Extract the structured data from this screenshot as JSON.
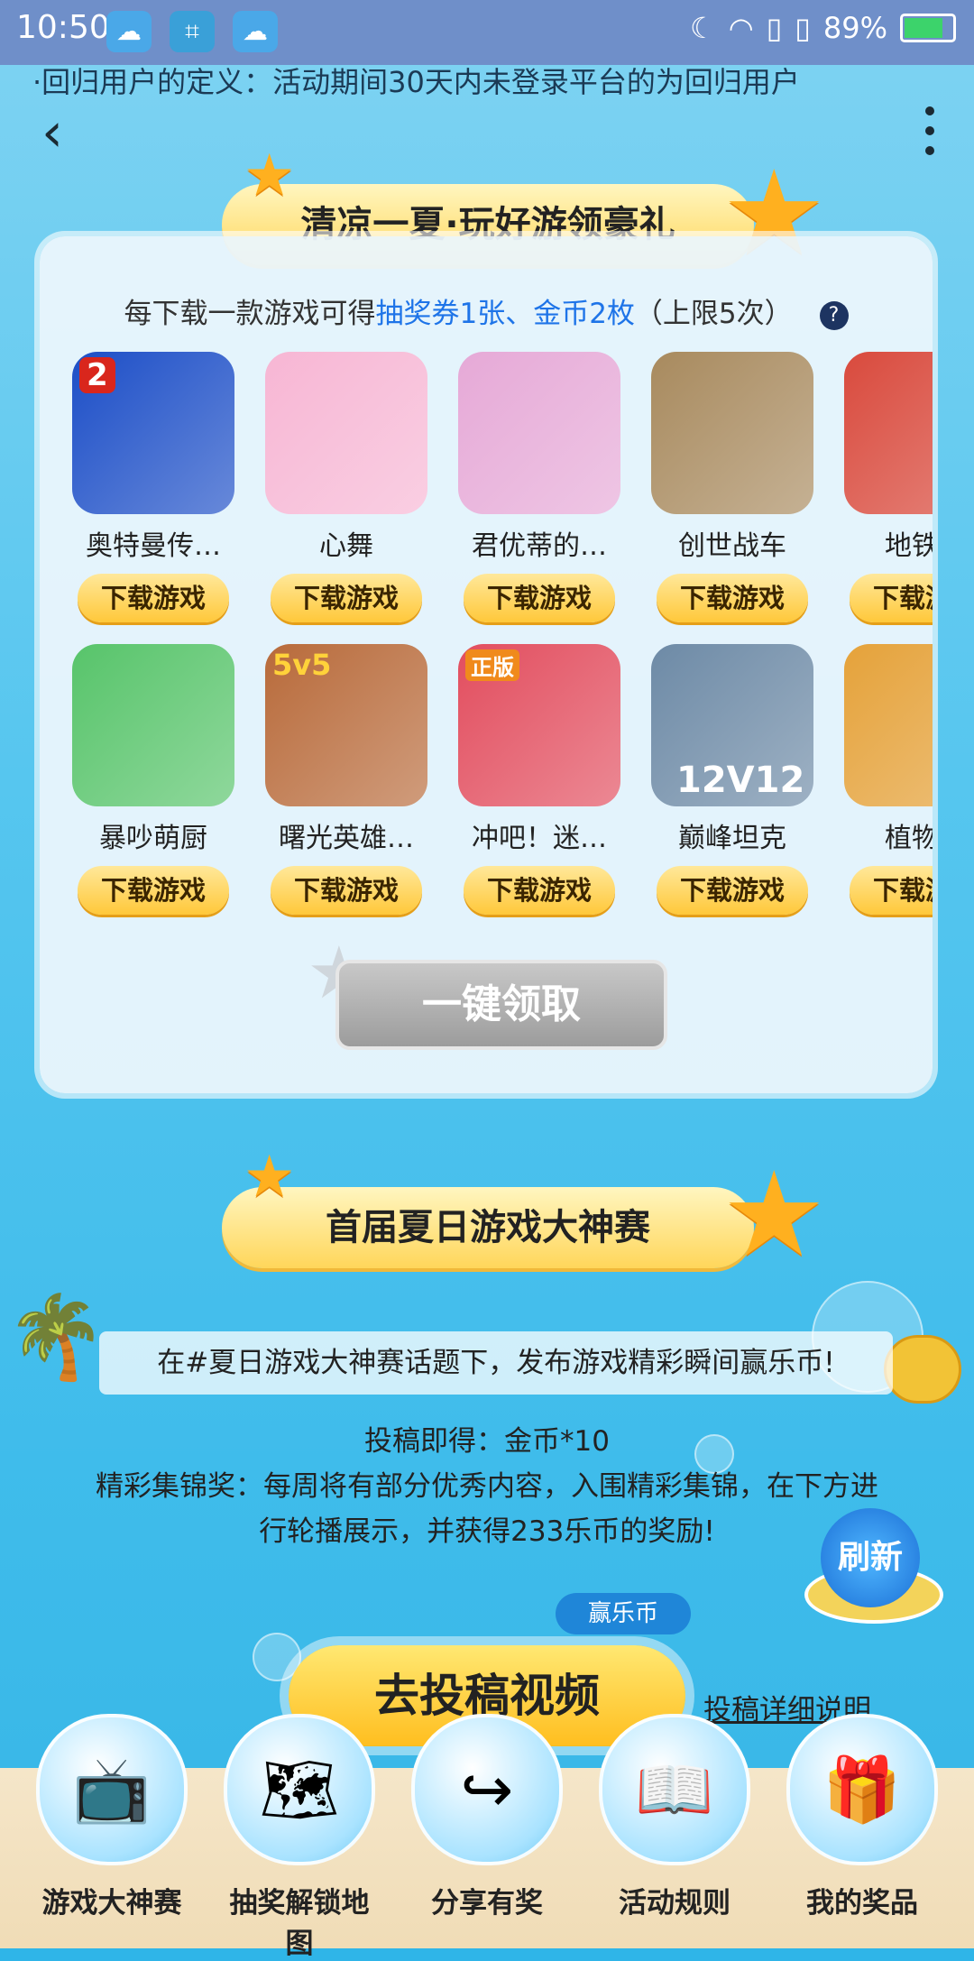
{
  "status_bar": {
    "time": "10:50",
    "battery": "89%"
  },
  "notice": "·回归用户的定义：活动期间30天内未登录平台的为回归用户",
  "section1": {
    "title": "清凉一夏·玩好游领豪礼",
    "rule_prefix": "每下载一款游戏可得",
    "rule_highlight": "抽奖券1张、金币2枚",
    "rule_suffix": "（上限5次）",
    "help": "?",
    "download_label": "下载游戏",
    "games": [
      {
        "name": "奥特曼传…",
        "color": "#1c4ec7"
      },
      {
        "name": "心舞",
        "color": "#f7b6d4"
      },
      {
        "name": "君优蒂的…",
        "color": "#e6a9d7"
      },
      {
        "name": "创世战车",
        "color": "#a88a5e"
      },
      {
        "name": "地铁跑",
        "color": "#d94a3d"
      },
      {
        "name": "暴吵萌厨",
        "color": "#57c46a"
      },
      {
        "name": "曙光英雄…",
        "color": "#b86a3a"
      },
      {
        "name": "冲吧！迷…",
        "color": "#e24d5e"
      },
      {
        "name": "巅峰坦克",
        "color": "#6d8aa6"
      },
      {
        "name": "植物大",
        "color": "#e5a23a"
      }
    ],
    "badges": [
      "2",
      "5v5",
      "正版",
      "12V12"
    ],
    "claim_label": "一键领取"
  },
  "section2": {
    "title": "首届夏日游戏大神赛",
    "strip": "在#夏日游戏大神赛话题下，发布游戏精彩瞬间赢乐币!",
    "line1": "投稿即得：金币*10",
    "line2": "精彩集锦奖：每周将有部分优秀内容，入围精彩集锦，在下方进",
    "line3": "行轮播展示，并获得233乐币的奖励!",
    "refresh": "刷新",
    "tag": "赢乐币",
    "submit": "去投稿视频",
    "detail": "投稿详细说明"
  },
  "bottom_nav": [
    {
      "label": "游戏大神赛",
      "icon": "tv-icon",
      "glyph": "📺"
    },
    {
      "label": "抽奖解锁地图",
      "icon": "map-icon",
      "glyph": "🗺"
    },
    {
      "label": "分享有奖",
      "icon": "share-icon",
      "glyph": "↪"
    },
    {
      "label": "活动规则",
      "icon": "book-icon",
      "glyph": "📖"
    },
    {
      "label": "我的奖品",
      "icon": "gift-icon",
      "glyph": "🎁"
    }
  ]
}
